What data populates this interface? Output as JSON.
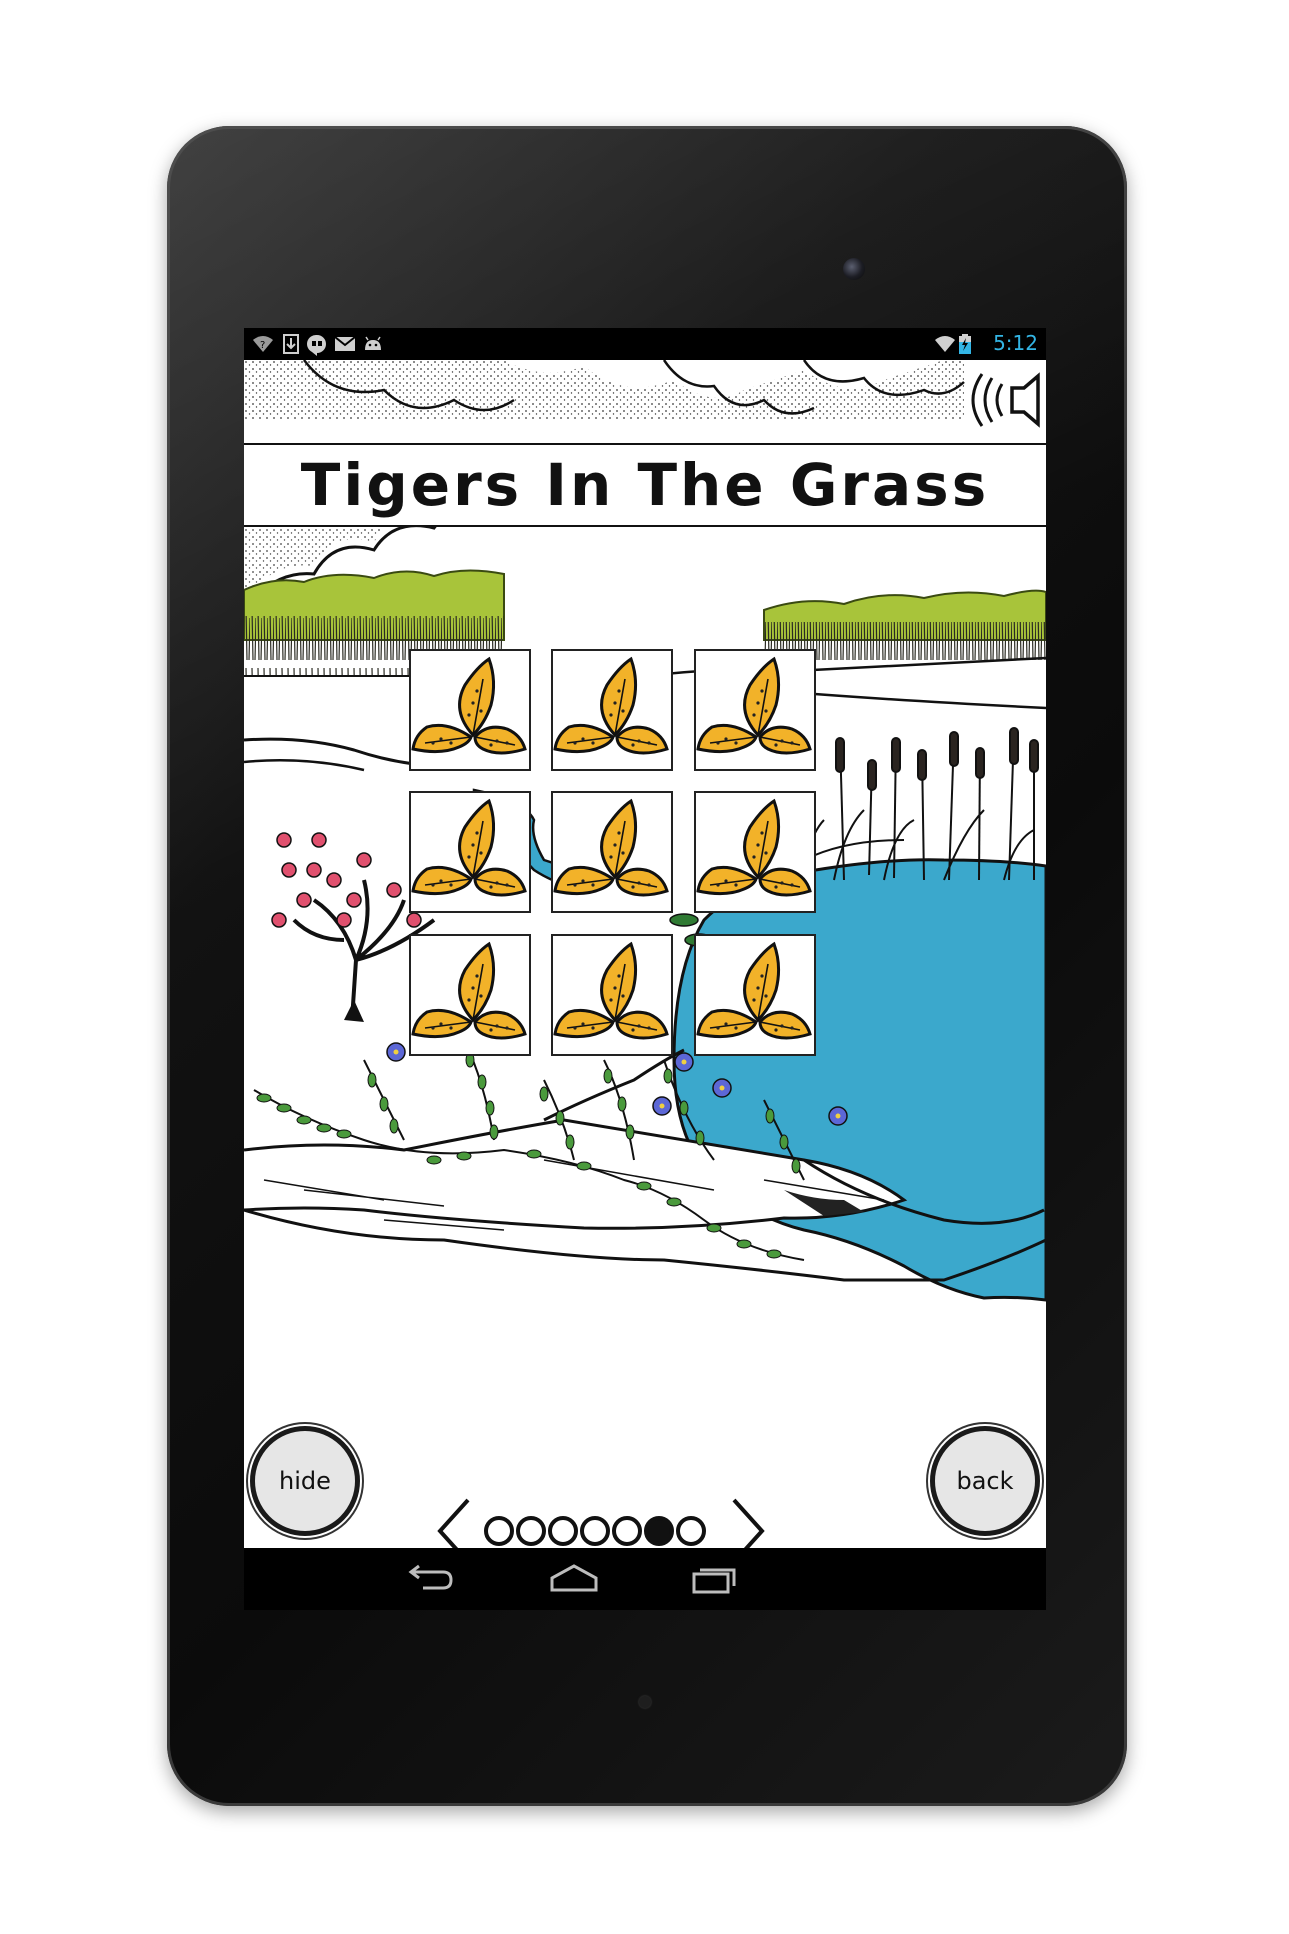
{
  "status_bar": {
    "left_icons": [
      "wifi-question-icon",
      "download-icon",
      "hangouts-icon",
      "gmail-icon",
      "android-icon"
    ],
    "right_icons": [
      "wifi-icon",
      "battery-charging-icon"
    ],
    "time": "5:12"
  },
  "app": {
    "title": "Tigers In The Grass",
    "sound_icon": "speaker-sound-icon",
    "tile_icon": "tiger-lily-icon",
    "tiles": [
      {
        "row": 1,
        "col": 1
      },
      {
        "row": 1,
        "col": 2
      },
      {
        "row": 1,
        "col": 3
      },
      {
        "row": 2,
        "col": 1
      },
      {
        "row": 2,
        "col": 2
      },
      {
        "row": 2,
        "col": 3
      },
      {
        "row": 3,
        "col": 1
      },
      {
        "row": 3,
        "col": 2
      },
      {
        "row": 3,
        "col": 3
      }
    ],
    "hide_label": "hide",
    "back_label": "back",
    "pager": {
      "page_count": 7,
      "current_page": 6,
      "prev_icon": "chevron-left-icon",
      "next_icon": "chevron-right-icon"
    }
  },
  "colors": {
    "pond": "#3ba8cc",
    "tree_line": "#a8c43a",
    "petal": "#f2b229",
    "blossom": "#e0506e",
    "wildflower": "#5c67d6",
    "leaf": "#4a9a3c",
    "status_accent": "#33b5e5"
  },
  "nav_bar": {
    "icons": [
      "back-icon",
      "home-icon",
      "recent-apps-icon"
    ]
  }
}
